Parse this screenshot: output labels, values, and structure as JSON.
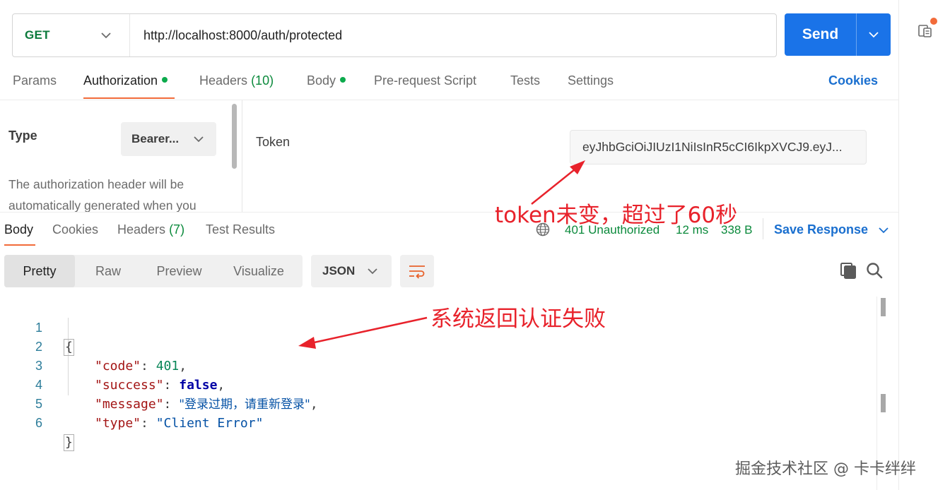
{
  "request": {
    "method": "GET",
    "url": "http://localhost:8000/auth/protected",
    "send_label": "Send"
  },
  "request_tabs": {
    "params": "Params",
    "authorization": "Authorization",
    "headers": "Headers",
    "headers_count": "(10)",
    "body": "Body",
    "prerequest": "Pre-request Script",
    "tests": "Tests",
    "settings": "Settings",
    "cookies": "Cookies"
  },
  "auth": {
    "type_label": "Type",
    "type_value": "Bearer...",
    "description": "The authorization header will be automatically generated when you",
    "token_label": "Token",
    "token_value": "eyJhbGciOiJIUzI1NiIsInR5cCI6IkpXVCJ9.eyJ..."
  },
  "response_tabs": {
    "body": "Body",
    "cookies": "Cookies",
    "headers": "Headers",
    "headers_count": "(7)",
    "test_results": "Test Results"
  },
  "response_meta": {
    "status": "401 Unauthorized",
    "time": "12 ms",
    "size": "338 B",
    "save_response": "Save Response"
  },
  "response_view": {
    "pretty": "Pretty",
    "raw": "Raw",
    "preview": "Preview",
    "visualize": "Visualize",
    "format": "JSON"
  },
  "code": {
    "line_numbers": [
      "1",
      "2",
      "3",
      "4",
      "5",
      "6"
    ],
    "open_brace": "{",
    "close_brace": "}",
    "k_code": "\"code\"",
    "v_code": "401",
    "k_success": "\"success\"",
    "v_success": "false",
    "k_message": "\"message\"",
    "v_message": "\"登录过期，请重新登录\"",
    "k_type": "\"type\"",
    "v_type": "\"Client Error\""
  },
  "annotations": {
    "token_note": "token未变，超过了60秒",
    "response_note": "系统返回认证失败"
  },
  "watermark": "掘金技术社区 @ 卡卡绊绊",
  "colors": {
    "send_blue": "#1a73e8",
    "method_green": "#0b7a3c",
    "status_green": "#0b8a3c",
    "active_orange": "#f26b3a",
    "link_blue": "#1a6fcf",
    "annotation_red": "#e8222b"
  }
}
